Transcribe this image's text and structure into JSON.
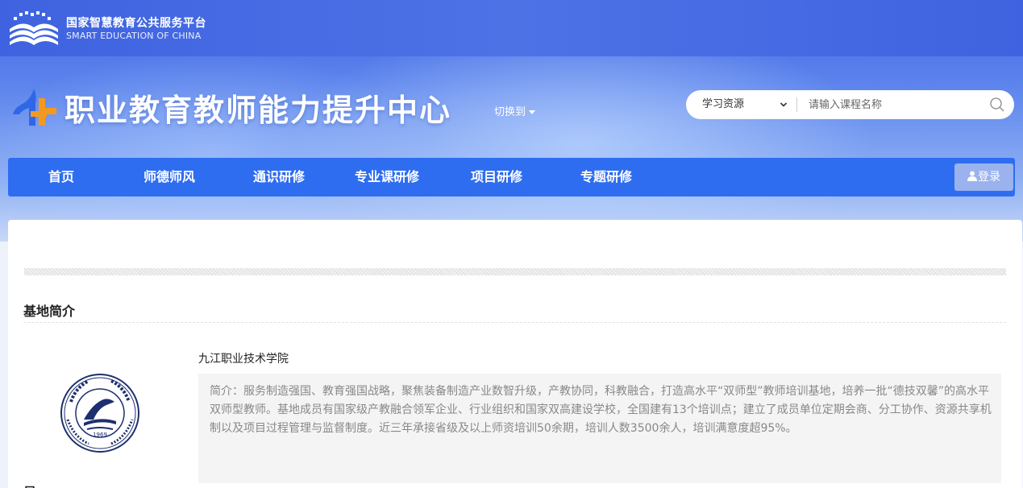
{
  "platform": {
    "name_cn": "国家智慧教育公共服务平台",
    "name_en": "SMART EDUCATION OF CHINA"
  },
  "header": {
    "title": "职业教育教师能力提升中心",
    "switch_label": "切换到"
  },
  "search": {
    "category": "学习资源",
    "placeholder": "请输入课程名称",
    "value": ""
  },
  "nav": {
    "items": [
      "首页",
      "师德师风",
      "通识研修",
      "专业课研修",
      "项目研修",
      "专题研修"
    ],
    "login_label": "登录"
  },
  "section": {
    "title": "基地简介",
    "school_name": "九江职业技术学院",
    "intro": "简介：服务制造强国、教育强国战略，聚焦装备制造产业数智升级，产教协同，科教融合，打造高水平“双师型”教师培训基地，培养一批“德技双馨”的高水平双师型教师。基地成员有国家级产教融合领军企业、行业组织和国家双高建设学校，全国建有13个培训点；建立了成员单位定期会商、分工协作、资源共享机制以及项目过程管理与监督制度。近三年承接省级及以上师资培训50余期，培训人数3500余人，培训满意度超95%。",
    "badge_year": "1969",
    "next_title": "是"
  },
  "colors": {
    "nav_blue": "#2e6df0",
    "header_blue": "#4166e4",
    "logo_orange": "#f39a1e"
  },
  "icons": [
    "platform-logo-icon",
    "center-logo-icon",
    "chevron-down-icon",
    "search-icon",
    "user-icon",
    "school-badge-icon"
  ]
}
